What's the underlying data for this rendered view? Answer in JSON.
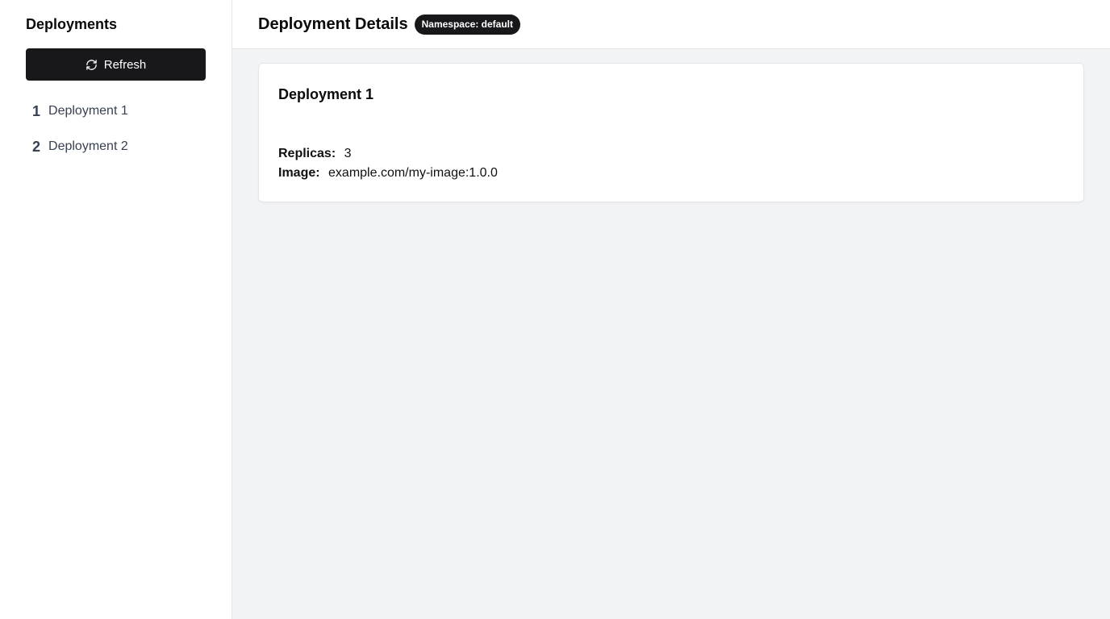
{
  "sidebar": {
    "title": "Deployments",
    "refresh_label": "Refresh",
    "refresh_icon": "refresh-icon",
    "items": [
      {
        "num": "1",
        "label": "Deployment 1"
      },
      {
        "num": "2",
        "label": "Deployment 2"
      }
    ]
  },
  "header": {
    "title": "Deployment Details",
    "namespace_badge": "Namespace: default"
  },
  "detail": {
    "name": "Deployment 1",
    "replicas_label": "Replicas:",
    "replicas_value": "3",
    "image_label": "Image:",
    "image_value": "example.com/my-image:1.0.0"
  },
  "colors": {
    "primary_button": "#18181b",
    "main_background": "#f2f3f5"
  }
}
